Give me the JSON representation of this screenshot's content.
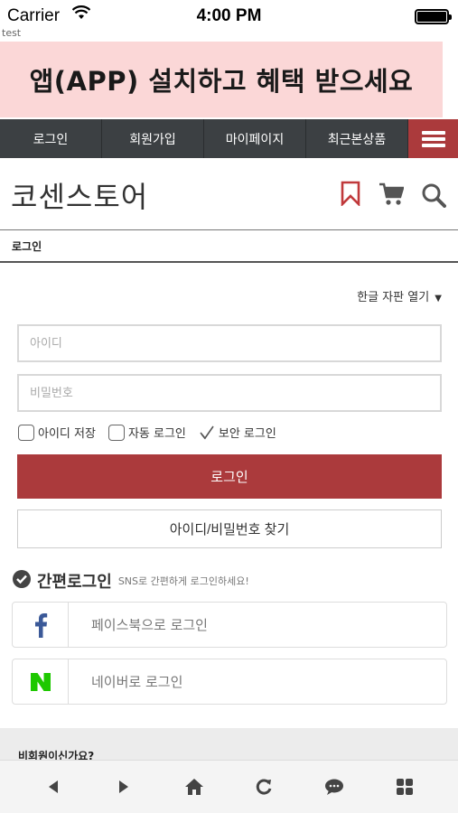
{
  "status_bar": {
    "carrier": "Carrier",
    "time": "4:00 PM"
  },
  "debug_label": "test",
  "banner": {
    "text": "앱(APP) 설치하고 혜택 받으세요"
  },
  "nav": {
    "items": [
      "로그인",
      "회원가입",
      "마이페이지",
      "최근본상품"
    ],
    "menu_icon": "hamburger-icon"
  },
  "header": {
    "logo": "코센스토어",
    "icons": [
      "bookmark-icon",
      "cart-icon",
      "search-icon"
    ]
  },
  "breadcrumb": {
    "current": "로그인"
  },
  "login_form": {
    "keyboard_toggle": "한글 자판 열기",
    "id_placeholder": "아이디",
    "password_placeholder": "비밀번호",
    "save_id_label": "아이디 저장",
    "auto_login_label": "자동 로그인",
    "secure_login_label": "보안 로그인",
    "login_button": "로그인",
    "find_button": "아이디/비밀번호 찾기"
  },
  "easy_login": {
    "title": "간편로그인",
    "subtitle": "SNS로 간편하게 로그인하세요!",
    "facebook_label": "페이스북으로 로그인",
    "naver_label": "네이버로 로그인"
  },
  "nonmember": {
    "text": "비회원이신가요?"
  },
  "colors": {
    "accent": "#ab3a3c",
    "nav_bg": "#3c4043",
    "banner_bg": "#fbd7d7",
    "facebook": "#3b5998",
    "naver": "#1ec800"
  },
  "toolbar": {
    "icons": [
      "back-icon",
      "forward-icon",
      "home-icon",
      "refresh-icon",
      "chat-icon",
      "grid-icon"
    ]
  }
}
